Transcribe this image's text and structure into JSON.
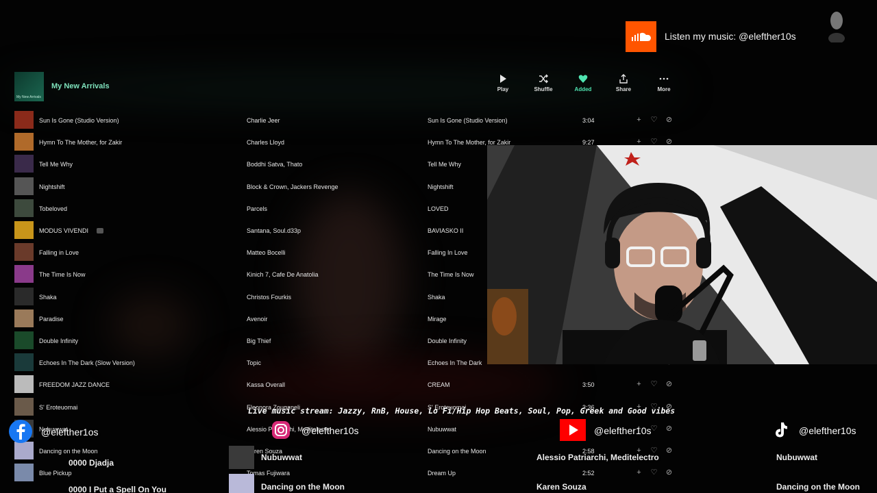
{
  "soundcloud": {
    "text": "Listen my music: @elefther10s",
    "icon": "soundcloud-icon",
    "color": "#ff5500"
  },
  "playlist": {
    "title": "My New Arrivals",
    "thumb_text": "My New Arrivals"
  },
  "actions": [
    {
      "label": "Play",
      "icon": "play-icon"
    },
    {
      "label": "Shuffle",
      "icon": "shuffle-icon"
    },
    {
      "label": "Added",
      "icon": "heart-icon"
    },
    {
      "label": "Share",
      "icon": "share-icon"
    },
    {
      "label": "More",
      "icon": "more-icon"
    }
  ],
  "accent_color": "#4fe3b0",
  "tracks": [
    {
      "title": "Sun Is Gone (Studio Version)",
      "artist": "Charlie Jeer",
      "album": "Sun Is Gone (Studio Version)",
      "duration": "3:04",
      "color": "#8a2a1a"
    },
    {
      "title": "Hymn To The Mother, for Zakir",
      "artist": "Charles Lloyd",
      "album": "Hymn To The Mother, for Zakir",
      "duration": "9:27",
      "color": "#b06a2a"
    },
    {
      "title": "Tell Me Why",
      "artist": "Boddhi Satva, Thato",
      "album": "Tell Me Why",
      "duration": "",
      "color": "#3a2a4a"
    },
    {
      "title": "Nightshift",
      "artist": "Block & Crown, Jackers Revenge",
      "album": "Nightshift",
      "duration": "",
      "color": "#555555"
    },
    {
      "title": "Tobeloved",
      "artist": "Parcels",
      "album": "LOVED",
      "duration": "",
      "color": "#3d4a3d"
    },
    {
      "title": "MODUS VIVENDI",
      "artist": "Santana, Soul.d33p",
      "album": "BAVIASKO II",
      "duration": "",
      "color": "#c8951a"
    },
    {
      "title": "Falling in Love",
      "artist": "Matteo Bocelli",
      "album": "Falling In Love",
      "duration": "",
      "color": "#6a3a2a"
    },
    {
      "title": "The Time Is Now",
      "artist": "Kinich 7, Cafe De Anatolia",
      "album": "The Time Is Now",
      "duration": "",
      "color": "#8a3a8a"
    },
    {
      "title": "Shaka",
      "artist": "Christos Fourkis",
      "album": "Shaka",
      "duration": "",
      "color": "#2a2a2a"
    },
    {
      "title": "Paradise",
      "artist": "Avenoir",
      "album": "Mirage",
      "duration": "",
      "color": "#9a7a5a"
    },
    {
      "title": "Double Infinity",
      "artist": "Big Thief",
      "album": "Double Infinity",
      "duration": "",
      "color": "#1a4a2a"
    },
    {
      "title": "Echoes In The Dark (Slow Version)",
      "artist": "Topic",
      "album": "Echoes In The Dark",
      "duration": "",
      "color": "#1a3a3a"
    },
    {
      "title": "FREEDOM JAZZ DANCE",
      "artist": "Kassa Overall",
      "album": "CREAM",
      "duration": "3:50",
      "color": "#bbbbbb"
    },
    {
      "title": "S' Eroteuomai",
      "artist": "Eleonora Zouganeli",
      "album": "S' Eroteuomai",
      "duration": "3:36",
      "color": "#6a5a4a"
    },
    {
      "title": "Nubuwwat",
      "artist": "Alessio Patriarchi, Meditelectro",
      "album": "Nubuwwat",
      "duration": "",
      "color": "#3a3a3a"
    },
    {
      "title": "Dancing on the Moon",
      "artist": "Karen Souza",
      "album": "Dancing on the Moon",
      "duration": "",
      "color": "#aaaacc"
    },
    {
      "title": "Blue Pickup",
      "artist": "Tomas Fujiwara",
      "album": "Dream Up",
      "duration": "2:52",
      "color": "#7a8aaa"
    }
  ],
  "partial_duration_1": "2:58",
  "tagline": "Live music stream: Jazzy, RnB, House, Lo Fi/Hip Hop Beats, Soul, Pop, Greek and Good vibes",
  "socials": [
    {
      "name": "facebook-icon",
      "handle": "@elefther1os",
      "color": "#1877f2"
    },
    {
      "name": "instagram-icon",
      "handle": "@elefther10s",
      "color": "#d62976"
    },
    {
      "name": "youtube-icon",
      "handle": "@elefther10s",
      "color": "#ff0000"
    },
    {
      "name": "tiktok-icon",
      "handle": "@elefther10s",
      "color": "#ffffff"
    }
  ],
  "overlay": {
    "left_line1": "0000 Djadja",
    "left_line2": "0000 I Put a Spell On You",
    "mid_title1": "Nubuwwat",
    "mid_title2": "Dancing on the Moon",
    "right_artist1": "Alessio Patriarchi, Meditelectro",
    "right_artist2": "Karen Souza",
    "far_right1": "Nubuwwat",
    "far_right2": "Dancing on the Moon"
  }
}
